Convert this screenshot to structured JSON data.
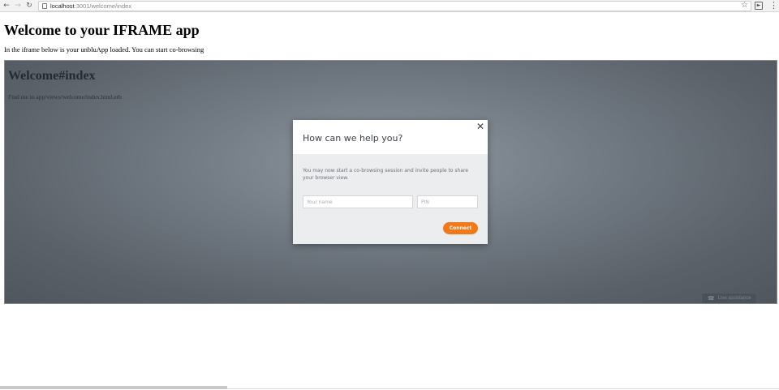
{
  "browser": {
    "url_host": "localhost",
    "url_rest": ":3001/welcome/index",
    "back_icon": "arrow-left-icon",
    "forward_icon": "arrow-right-icon",
    "reload_icon": "reload-icon",
    "star_icon": "star-icon",
    "menu_icon": "kebab-menu-icon"
  },
  "page": {
    "title": "Welcome to your IFRAME app",
    "intro": "In the iframe below is your unbluApp loaded. You can start co-browsing"
  },
  "iframe": {
    "title": "Welcome#index",
    "text": "Find me in app/views/welcome/index.html.erb",
    "live_button_label": "Live assistance"
  },
  "modal": {
    "title": "How can we help you?",
    "close_icon": "close-icon",
    "description": "You may now start a co-browsing session and invite people to share your browser view.",
    "name_placeholder": "Your name",
    "pin_placeholder": "PIN",
    "connect_label": "Connect",
    "accent_color": "#f07a1a"
  }
}
